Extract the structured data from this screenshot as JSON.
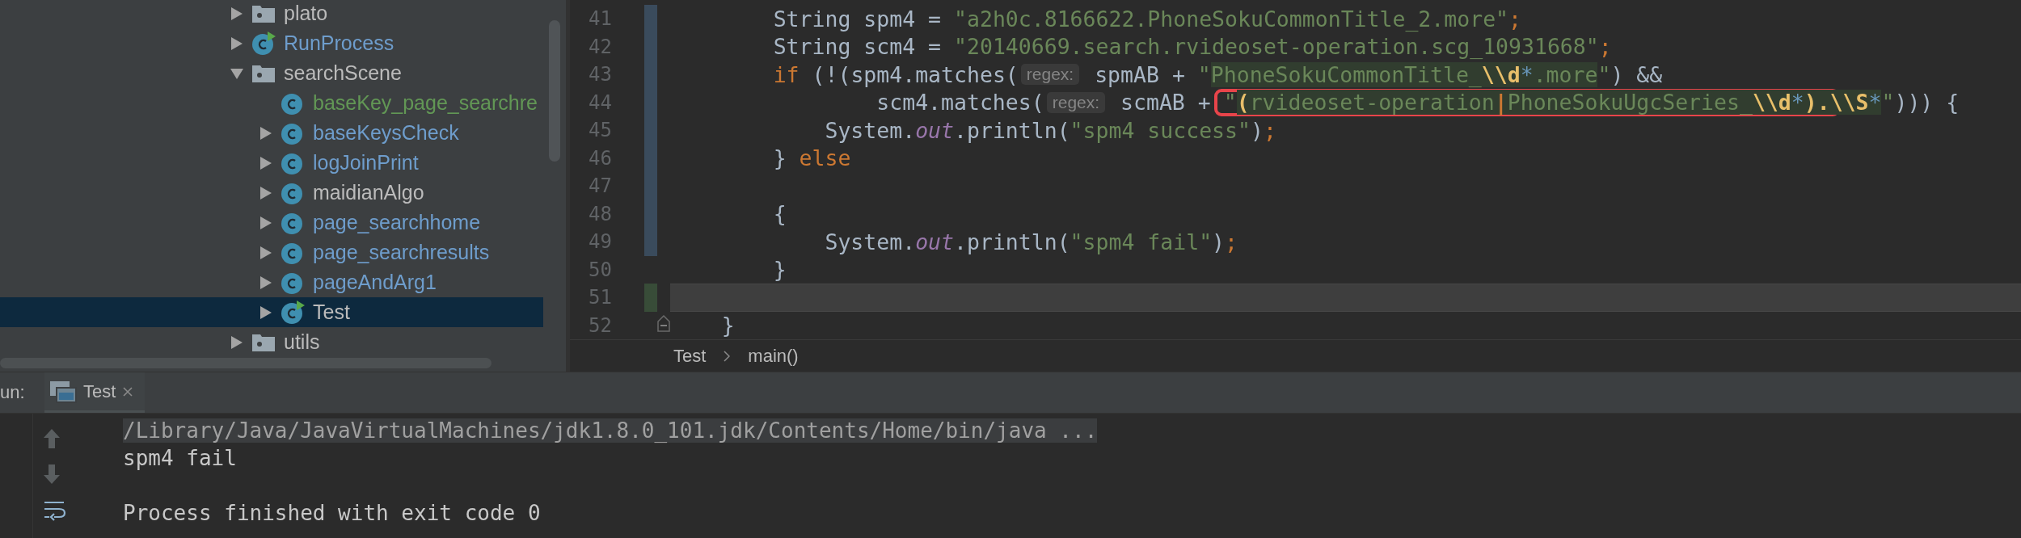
{
  "project_tree": {
    "items": [
      {
        "label": "plato",
        "kind": "package",
        "color": "#bbbbbb",
        "expanded": false,
        "selected": false
      },
      {
        "label": "RunProcess",
        "kind": "runnable-class",
        "color": "#6e9dcc",
        "expanded": false,
        "selected": false
      },
      {
        "label": "searchScene",
        "kind": "package",
        "color": "#bbbbbb",
        "expanded": true,
        "selected": false,
        "children": [
          {
            "label": "baseKey_page_searchre",
            "kind": "class",
            "color": "#629755",
            "selected": false
          },
          {
            "label": "baseKeysCheck",
            "kind": "class",
            "color": "#6e9dcc",
            "expanded": false,
            "selected": false
          },
          {
            "label": "logJoinPrint",
            "kind": "class",
            "color": "#6e9dcc",
            "expanded": false,
            "selected": false
          },
          {
            "label": "maidianAlgo",
            "kind": "class",
            "color": "#bbbbbb",
            "expanded": false,
            "selected": false
          },
          {
            "label": "page_searchhome",
            "kind": "class",
            "color": "#6e9dcc",
            "expanded": false,
            "selected": false
          },
          {
            "label": "page_searchresults",
            "kind": "class",
            "color": "#6e9dcc",
            "expanded": false,
            "selected": false
          },
          {
            "label": "pageAndArg1",
            "kind": "class",
            "color": "#6e9dcc",
            "expanded": false,
            "selected": false
          },
          {
            "label": "Test",
            "kind": "runnable-class",
            "color": "#bbbbbb",
            "expanded": false,
            "selected": true
          }
        ]
      },
      {
        "label": "utils",
        "kind": "package",
        "color": "#bbbbbb",
        "expanded": false,
        "selected": false
      }
    ]
  },
  "editor": {
    "lines": [
      {
        "number": "41",
        "modified": true,
        "added": false,
        "current": false,
        "fold": false,
        "tokens": [
          {
            "kind": "plain",
            "text": "        String spm4 = "
          },
          {
            "kind": "string",
            "text": "\"a2h0c.8166622.PhoneSokuCommonTitle_2.more\""
          },
          {
            "kind": "punct",
            "text": ";"
          }
        ]
      },
      {
        "number": "42",
        "modified": true,
        "added": false,
        "current": false,
        "fold": false,
        "tokens": [
          {
            "kind": "plain",
            "text": "        String scm4 = "
          },
          {
            "kind": "string",
            "text": "\"20140669.search.rvideoset-operation.scg_10931668\""
          },
          {
            "kind": "punct",
            "text": ";"
          }
        ]
      },
      {
        "number": "43",
        "modified": true,
        "added": false,
        "current": false,
        "fold": false,
        "tokens": [
          {
            "kind": "keyword",
            "text": "        if"
          },
          {
            "kind": "plain",
            "text": " (!(spm4.matches("
          },
          {
            "kind": "hint",
            "text": "regex:"
          },
          {
            "kind": "plain",
            "text": " spmAB + "
          },
          {
            "kind": "string",
            "text": "\""
          },
          {
            "kind": "regex-text",
            "text": "PhoneSokuCommonTitle_"
          },
          {
            "kind": "regex-escape",
            "text": "\\\\d"
          },
          {
            "kind": "regex-quantifier",
            "text": "*"
          },
          {
            "kind": "regex-text",
            "text": ".more"
          },
          {
            "kind": "string",
            "text": "\""
          },
          {
            "kind": "plain",
            "text": ") &&"
          }
        ]
      },
      {
        "number": "44",
        "modified": true,
        "added": false,
        "current": false,
        "fold": false,
        "tokens": [
          {
            "kind": "plain",
            "text": "                scm4.matches("
          },
          {
            "kind": "hint",
            "text": "regex:"
          },
          {
            "kind": "plain",
            "text": " scmAB + "
          },
          {
            "kind": "frame",
            "tokens": [
              {
                "kind": "string",
                "text": "\""
              },
              {
                "kind": "regex-group",
                "text": "("
              },
              {
                "kind": "regex-text",
                "text": "rvideoset-operation"
              },
              {
                "kind": "regex-alternation",
                "text": "|"
              },
              {
                "kind": "regex-text",
                "text": "PhoneSokuUgcSeries_"
              },
              {
                "kind": "regex-escape",
                "text": "\\\\d"
              },
              {
                "kind": "regex-quantifier",
                "text": "*"
              },
              {
                "kind": "regex-group",
                "text": ")."
              }
            ]
          },
          {
            "kind": "regex-escape",
            "text": "\\\\S"
          },
          {
            "kind": "regex-quantifier",
            "text": "*"
          },
          {
            "kind": "string",
            "text": "\""
          },
          {
            "kind": "plain",
            "text": "))) {"
          }
        ]
      },
      {
        "number": "45",
        "modified": true,
        "added": false,
        "current": false,
        "fold": false,
        "tokens": [
          {
            "kind": "plain",
            "text": "            System."
          },
          {
            "kind": "field",
            "text": "out"
          },
          {
            "kind": "plain",
            "text": ".println("
          },
          {
            "kind": "string",
            "text": "\"spm4 success\""
          },
          {
            "kind": "plain",
            "text": ")"
          },
          {
            "kind": "punct",
            "text": ";"
          }
        ]
      },
      {
        "number": "46",
        "modified": true,
        "added": false,
        "current": false,
        "fold": false,
        "tokens": [
          {
            "kind": "plain",
            "text": "        } "
          },
          {
            "kind": "keyword",
            "text": "else"
          }
        ]
      },
      {
        "number": "47",
        "modified": true,
        "added": false,
        "current": false,
        "fold": false
      },
      {
        "number": "48",
        "modified": true,
        "added": false,
        "current": false,
        "fold": false,
        "tokens": [
          {
            "kind": "plain",
            "text": "        {"
          }
        ]
      },
      {
        "number": "49",
        "modified": true,
        "added": false,
        "current": false,
        "fold": false,
        "tokens": [
          {
            "kind": "plain",
            "text": "            System."
          },
          {
            "kind": "field",
            "text": "out"
          },
          {
            "kind": "plain",
            "text": ".println("
          },
          {
            "kind": "string",
            "text": "\"spm4 fail\""
          },
          {
            "kind": "plain",
            "text": ")"
          },
          {
            "kind": "punct",
            "text": ";"
          }
        ]
      },
      {
        "number": "50",
        "modified": false,
        "added": false,
        "current": false,
        "fold": false,
        "tokens": [
          {
            "kind": "plain",
            "text": "        }"
          }
        ]
      },
      {
        "number": "51",
        "modified": false,
        "added": true,
        "current": true,
        "fold": false
      },
      {
        "number": "52",
        "modified": false,
        "added": false,
        "current": false,
        "fold": true,
        "tokens": [
          {
            "kind": "plain",
            "text": "    }"
          }
        ]
      }
    ],
    "breadcrumbs": [
      "Test",
      "main()"
    ]
  },
  "run_panel": {
    "label": "un:",
    "tabs": [
      {
        "label": "Test",
        "selected": true
      }
    ],
    "console": [
      {
        "kind": "command",
        "text": "/Library/Java/JavaVirtualMachines/jdk1.8.0_101.jdk/Contents/Home/bin/java ..."
      },
      {
        "kind": "output",
        "text": "spm4 fail"
      },
      {
        "kind": "blank"
      },
      {
        "kind": "output",
        "text": "Process finished with exit code 0"
      }
    ]
  }
}
